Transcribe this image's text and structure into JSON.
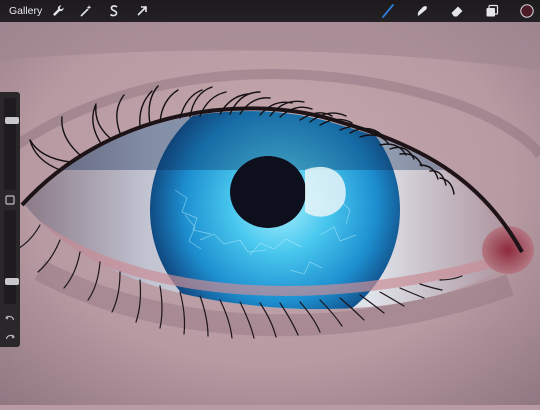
{
  "app": {
    "gallery_label": "Gallery"
  },
  "toolbar": {
    "left_tools": [
      "wrench-icon",
      "magic-wand-icon",
      "selection-s-icon",
      "transform-arrow-icon"
    ],
    "right_tools": [
      "brush-icon",
      "smudge-icon",
      "eraser-icon",
      "layers-icon"
    ],
    "active_tool": "brush",
    "active_color": "#4a1a26",
    "accent_color": "#2f7bd8"
  },
  "sidebar": {
    "brush_size_level": 0.78,
    "opacity_level": 0.22,
    "icons": [
      "square-modify-icon",
      "undo-icon",
      "redo-icon"
    ]
  },
  "canvas": {
    "subject": "eye-painting",
    "iris_color": "#2eb6e6",
    "pupil_color": "#0d0f1c"
  }
}
